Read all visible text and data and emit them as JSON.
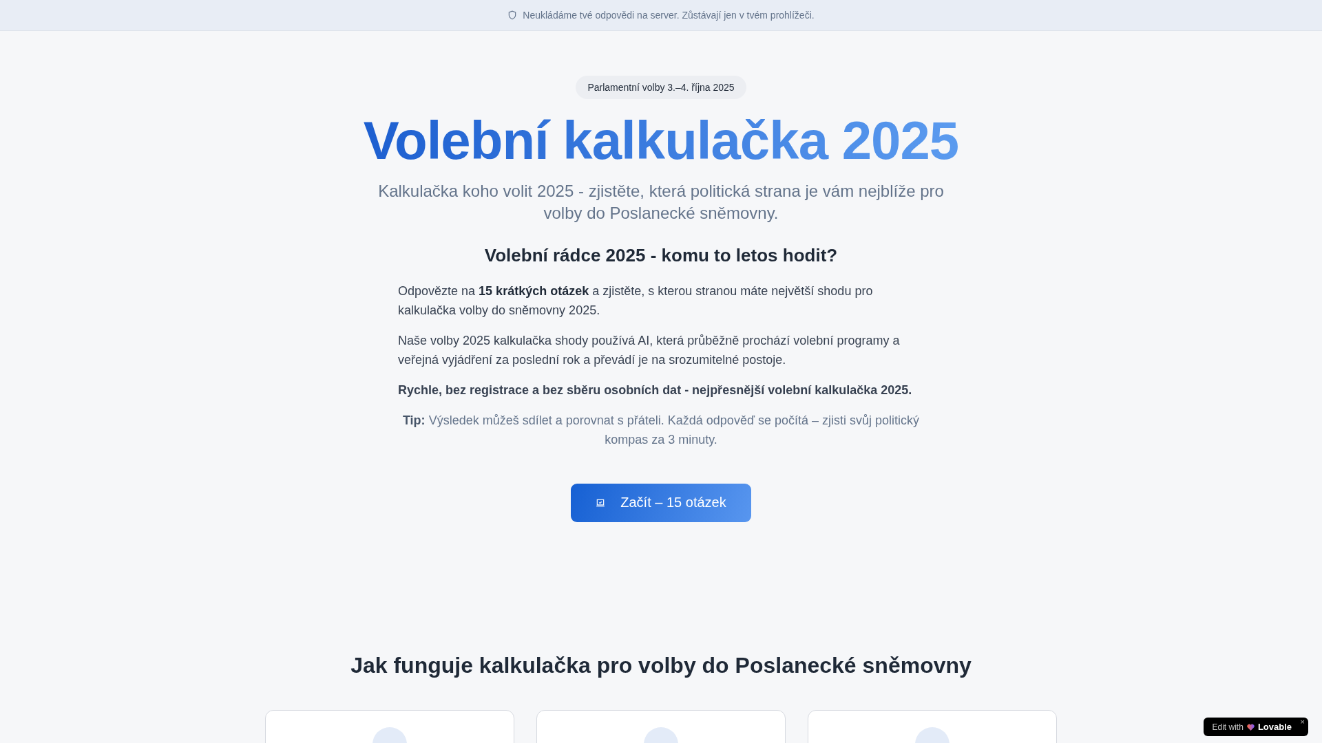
{
  "notice_bar": {
    "text": "Neukládáme tvé odpovědi na server. Zůstávají jen v tvém prohlížeči."
  },
  "hero": {
    "badge": "Parlamentní volby 3.–4. října 2025",
    "title": "Volební kalkulačka 2025",
    "subtitle": "Kalkulačka koho volit 2025 - zjistěte, která politická strana je vám nejblíže pro volby do Poslanecké sněmovny.",
    "heading": "Volební rádce 2025 - komu to letos hodit?",
    "paragraphs": [
      {
        "kind": "normal",
        "text": "Odpovězte na **15 krátkých otázek** a zjistěte, s kterou stranou máte největší shodu pro kalkulačka volby do sněmovny 2025."
      },
      {
        "kind": "normal",
        "text": "Naše volby 2025 kalkulačka shody používá AI, která průběžně prochází volební programy a veřejná vyjádření za poslední rok a převádí je na srozumitelné postoje."
      },
      {
        "kind": "strong",
        "text": "Rychle, bez registrace a bez sběru osobních dat - nejpřesnější volební kalkulačka 2025."
      },
      {
        "kind": "tip",
        "text": "**Tip:** Výsledek můžeš sdílet a porovnat s přáteli. Každá odpověď se počítá – zjisti svůj politický kompas za 3 minuty."
      }
    ],
    "start_button": "Začít – 15 otázek"
  },
  "how_it_works": {
    "heading": "Jak funguje kalkulačka pro volby do Poslanecké sněmovny",
    "cards": [
      {
        "kind": "step"
      },
      {
        "kind": "step"
      },
      {
        "kind": "step"
      }
    ]
  },
  "edit_badge": {
    "prefix": "Edit with",
    "brand": "Lovable",
    "close": "×"
  }
}
